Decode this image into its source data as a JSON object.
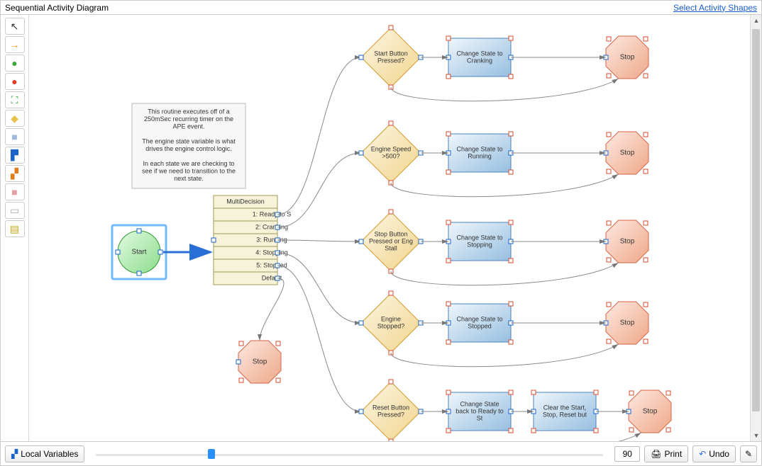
{
  "header": {
    "title": "Sequential Activity Diagram",
    "link": "Select Activity Shapes"
  },
  "toolbar": [
    {
      "name": "pointer",
      "glyph": "↖",
      "color": "#333"
    },
    {
      "name": "arrow",
      "glyph": "→",
      "color": "#f39018"
    },
    {
      "name": "green-circle",
      "glyph": "●",
      "color": "#3aa93a"
    },
    {
      "name": "red-circle",
      "glyph": "●",
      "color": "#e33a28"
    },
    {
      "name": "expand",
      "glyph": "⛶",
      "color": "#2f9d2f"
    },
    {
      "name": "diamond",
      "glyph": "◆",
      "color": "#e8c24e"
    },
    {
      "name": "square",
      "glyph": "■",
      "color": "#9fb9de"
    },
    {
      "name": "flag",
      "glyph": "▛",
      "color": "#1a64c8"
    },
    {
      "name": "stack",
      "glyph": "▞",
      "color": "#e27d1a"
    },
    {
      "name": "box",
      "glyph": "■",
      "color": "#e7a0a0"
    },
    {
      "name": "doc",
      "glyph": "▭",
      "color": "#aaa"
    },
    {
      "name": "table",
      "glyph": "▤",
      "color": "#c6a812"
    }
  ],
  "note": {
    "lines": [
      "This routine executes off of a",
      "250mSec recurring timer on the",
      "APE event.",
      "",
      "The engine state variable is what",
      "drives the engine control logic.",
      "",
      "In each state we are checking to",
      "see if we need to transition to the",
      "next state."
    ]
  },
  "start": {
    "label": "Start"
  },
  "multi": {
    "title": "MultiDecision",
    "rows": [
      "1: Ready to S",
      "2: Cranking",
      "3: Running",
      "4: Stopping",
      "5: Stopped",
      "Default"
    ]
  },
  "branches": [
    {
      "decision": "Start Button Pressed?",
      "process": "Change State to Cranking",
      "stop": "Stop"
    },
    {
      "decision": "Engine Speed >500?",
      "process": "Change State to Running",
      "stop": "Stop"
    },
    {
      "decision": "Stop Button Pressed or Eng Stall",
      "process": "Change State to Stopping",
      "stop": "Stop"
    },
    {
      "decision": "Engine Stopped?",
      "process": "Change State to Stopped",
      "stop": "Stop"
    },
    {
      "decision": "Reset Button Pressed?",
      "process": "Change State back to Ready to St",
      "process2": "Clear the Start, Stop, Reset but",
      "stop": "Stop"
    }
  ],
  "default_stop": "Stop",
  "footer": {
    "local_vars": "Local Variables",
    "zoom": "90",
    "print": "Print",
    "undo": "Undo"
  },
  "colors": {
    "start_fill": "#a4e9a4",
    "start_stroke": "#2e9b2e",
    "note_fill": "#f7f7f7",
    "note_stroke": "#b8b8b8",
    "multi_fill": "#f6f3d8",
    "multi_stroke": "#a09a5a",
    "dec_fill": "url(#gDec)",
    "dec_stroke": "#cf9c32",
    "proc_fill": "url(#gProc)",
    "proc_stroke": "#4a84bd",
    "stop_fill": "url(#gStop)",
    "stop_stroke": "#d66348",
    "handle": "#d84a2b"
  }
}
